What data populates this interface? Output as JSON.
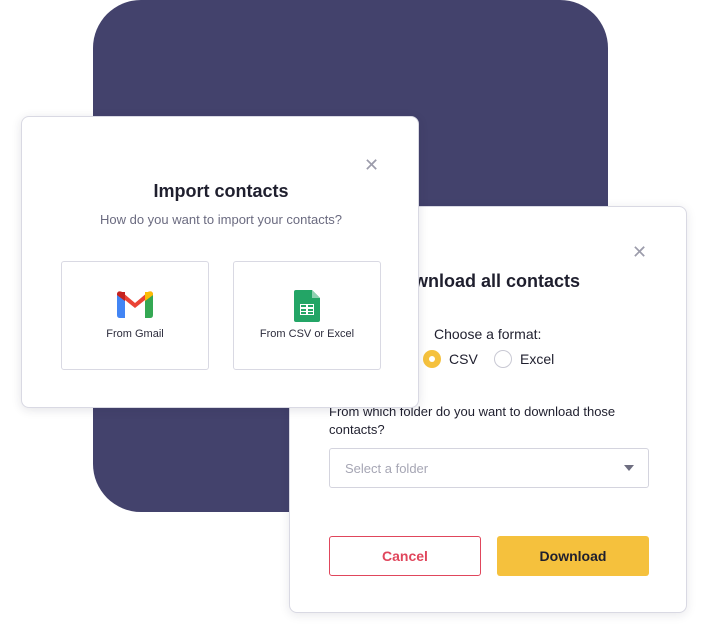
{
  "import_modal": {
    "close_glyph": "✕",
    "title": "Import contacts",
    "subtitle": "How do you want to import your contacts?",
    "options": [
      {
        "label": "From Gmail",
        "icon": "gmail-icon"
      },
      {
        "label": "From CSV or Excel",
        "icon": "spreadsheet-icon"
      }
    ]
  },
  "download_modal": {
    "close_glyph": "✕",
    "title": "Download all contacts",
    "format_label": "Choose a format:",
    "formats": [
      {
        "label": "CSV",
        "selected": true
      },
      {
        "label": "Excel",
        "selected": false
      }
    ],
    "folder_question": "From which folder do you want to download those contacts?",
    "folder_placeholder": "Select a folder",
    "cancel_label": "Cancel",
    "download_label": "Download"
  },
  "colors": {
    "backdrop": "#43426c",
    "accent": "#f5c13d",
    "danger": "#e0465c"
  }
}
